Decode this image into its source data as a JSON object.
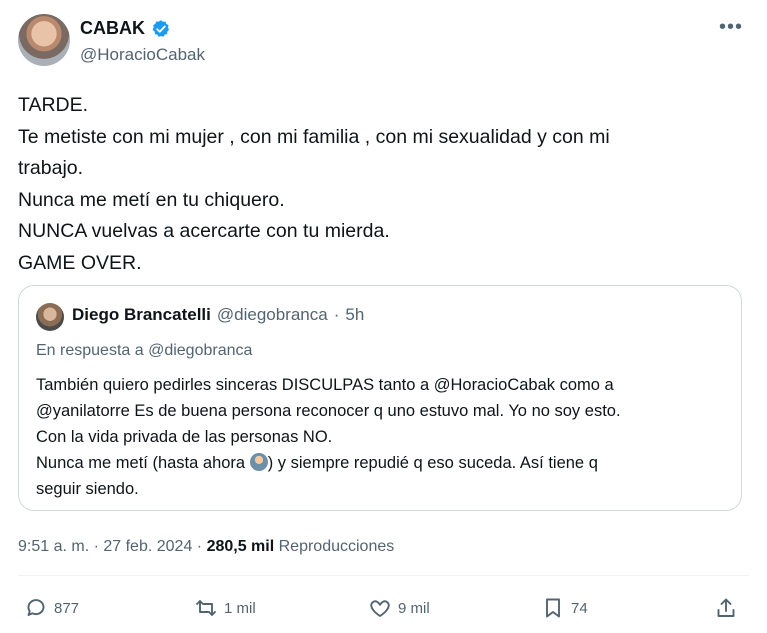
{
  "author": {
    "name": "CABAK",
    "handle": "@HoracioCabak"
  },
  "tweet": {
    "lines": [
      "TARDE.",
      "Te metiste con mi mujer , con mi familia , con mi sexualidad y con mi",
      "trabajo.",
      "Nunca me metí en tu chiquero.",
      "NUNCA vuelvas a acercarte con tu mierda.",
      "GAME OVER."
    ]
  },
  "quote": {
    "name": "Diego Brancatelli",
    "handle": "@diegobranca",
    "separator": "·",
    "time": "5h",
    "reply_prefix": "En respuesta a",
    "reply_to": "@diegobranca",
    "lines": [
      "También quiero pedirles sinceras DISCULPAS tanto a @HoracioCabak como a",
      "@yanilatorre Es de buena persona reconocer q uno estuvo mal. Yo no soy esto.",
      "Con la vida privada de las personas NO."
    ],
    "line4_before": "Nunca me metí (hasta ahora ",
    "line4_after": ") y siempre repudié q eso suceda. Así tiene q",
    "line5": "seguir siendo."
  },
  "meta": {
    "time": "9:51 a. m. · 27 feb. 2024 · ",
    "views_count": "280,5 mil",
    "views_label": " Reproducciones"
  },
  "actions": {
    "replies": "877",
    "retweets": "1 mil",
    "likes": "9 mil",
    "bookmarks": "74"
  },
  "icons": {
    "verified": "verified-badge-icon",
    "more": "more-icon",
    "reply": "reply-icon",
    "retweet": "retweet-icon",
    "like": "heart-icon",
    "bookmark": "bookmark-icon",
    "share": "share-icon"
  },
  "colors": {
    "verified": "#1d9bf0",
    "secondary_text": "#536471",
    "border": "#cfd9de"
  }
}
